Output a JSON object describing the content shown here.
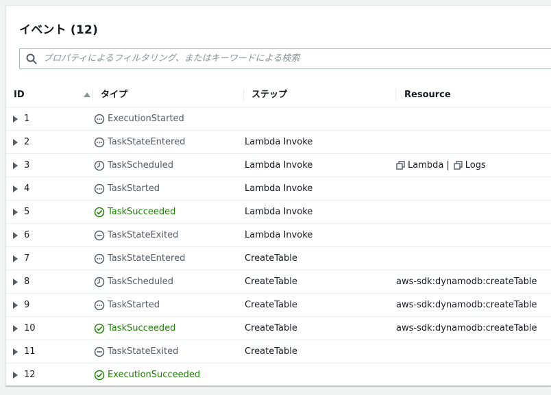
{
  "header": {
    "title": "イベント (12)"
  },
  "search": {
    "placeholder": "プロパティによるフィルタリング、またはキーワードによる検索"
  },
  "columns": {
    "id": "ID",
    "type": "タイプ",
    "step": "ステップ",
    "resource": "Resource"
  },
  "colors": {
    "success": "#1d8102",
    "neutral": "#545b64"
  },
  "events": [
    {
      "id": "1",
      "type": "ExecutionStarted",
      "icon": "dash-circle-icon",
      "status": "neutral",
      "step": "",
      "resource": ""
    },
    {
      "id": "2",
      "type": "TaskStateEntered",
      "icon": "dash-circle-icon",
      "status": "neutral",
      "step": "Lambda Invoke",
      "resource": ""
    },
    {
      "id": "3",
      "type": "TaskScheduled",
      "icon": "clock-icon",
      "status": "neutral",
      "step": "Lambda Invoke",
      "resource": "",
      "resource_links": [
        "Lambda",
        "Logs"
      ]
    },
    {
      "id": "4",
      "type": "TaskStarted",
      "icon": "dash-circle-icon",
      "status": "neutral",
      "step": "Lambda Invoke",
      "resource": ""
    },
    {
      "id": "5",
      "type": "TaskSucceeded",
      "icon": "check-circle-icon",
      "status": "success",
      "step": "Lambda Invoke",
      "resource": ""
    },
    {
      "id": "6",
      "type": "TaskStateExited",
      "icon": "minus-circle-icon",
      "status": "neutral",
      "step": "Lambda Invoke",
      "resource": ""
    },
    {
      "id": "7",
      "type": "TaskStateEntered",
      "icon": "dash-circle-icon",
      "status": "neutral",
      "step": "CreateTable",
      "resource": ""
    },
    {
      "id": "8",
      "type": "TaskScheduled",
      "icon": "clock-icon",
      "status": "neutral",
      "step": "CreateTable",
      "resource": "aws-sdk:dynamodb:createTable"
    },
    {
      "id": "9",
      "type": "TaskStarted",
      "icon": "dash-circle-icon",
      "status": "neutral",
      "step": "CreateTable",
      "resource": "aws-sdk:dynamodb:createTable"
    },
    {
      "id": "10",
      "type": "TaskSucceeded",
      "icon": "check-circle-icon",
      "status": "success",
      "step": "CreateTable",
      "resource": "aws-sdk:dynamodb:createTable"
    },
    {
      "id": "11",
      "type": "TaskStateExited",
      "icon": "minus-circle-icon",
      "status": "neutral",
      "step": "CreateTable",
      "resource": ""
    },
    {
      "id": "12",
      "type": "ExecutionSucceeded",
      "icon": "check-circle-icon",
      "status": "success",
      "step": "",
      "resource": ""
    }
  ]
}
